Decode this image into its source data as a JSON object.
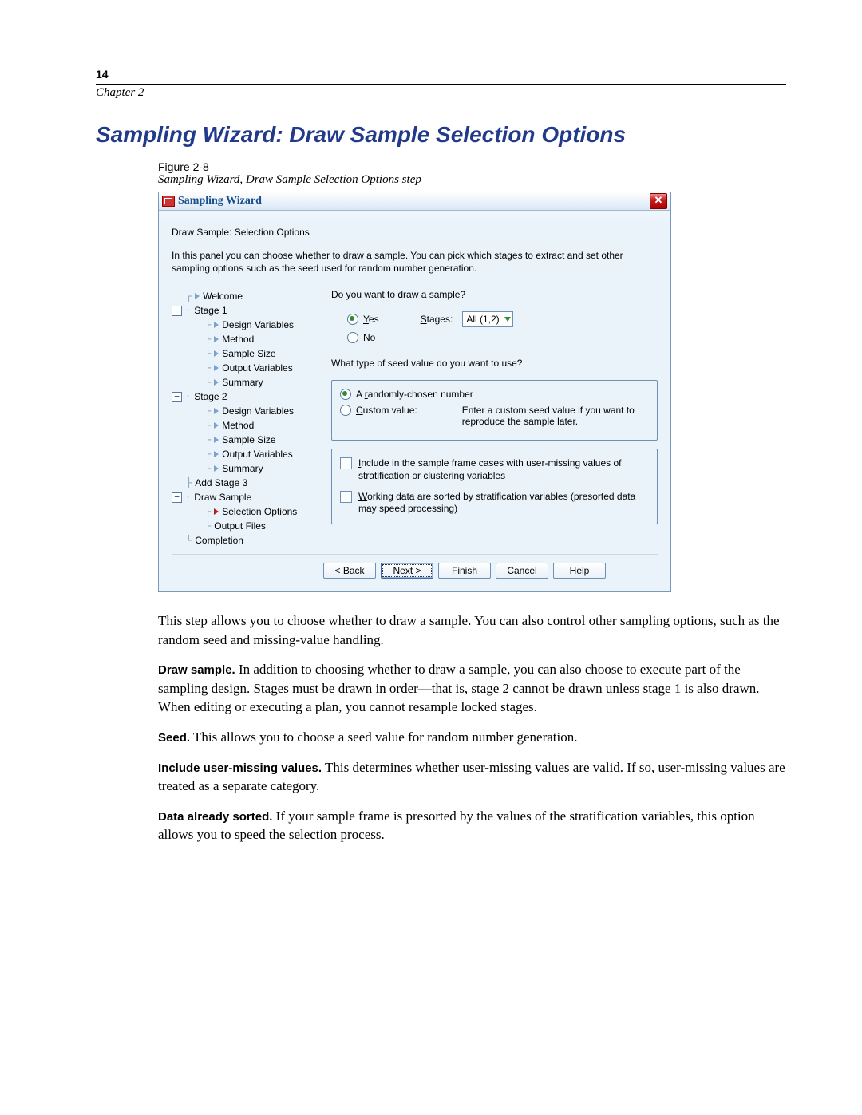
{
  "page_number": "14",
  "chapter": "Chapter 2",
  "headline": "Sampling Wizard: Draw Sample Selection Options",
  "figure_label": "Figure 2-8",
  "figure_caption": "Sampling Wizard, Draw Sample Selection Options step",
  "dialog": {
    "title": "Sampling Wizard",
    "close": "✕",
    "panel_title": "Draw Sample: Selection Options",
    "panel_text": "In this panel you can choose whether to draw  a sample. You can pick which stages to extract and set other sampling options such as the seed used for random number generation.",
    "tree": {
      "welcome": "Welcome",
      "stage1": "Stage 1",
      "design_vars": "Design Variables",
      "method": "Method",
      "sample_size": "Sample Size",
      "output_vars": "Output Variables",
      "summary": "Summary",
      "stage2": "Stage 2",
      "add_stage3": "Add Stage 3",
      "draw_sample": "Draw Sample",
      "selection_options": "Selection Options",
      "output_files": "Output Files",
      "completion": "Completion"
    },
    "right": {
      "q1": "Do you want to draw a sample?",
      "yes_html": "<span class='u'>Y</span>es",
      "no_html": "N<span class='u'>o</span>",
      "stages_label_html": "<span class='u'>S</span>tages:",
      "stages_value": "All (1,2)",
      "q2": "What type of seed value do you want to use?",
      "random_html": "A <span class='u'>r</span>andomly-chosen number",
      "custom_html": "<span class='u'>C</span>ustom value:",
      "custom_hint": "Enter a custom seed value if you want to reproduce the sample later.",
      "chk1_html": "<span class='u'>I</span>nclude in the sample frame cases with user-missing values of stratification or clustering variables",
      "chk2_html": "<span class='u'>W</span>orking data are sorted by stratification variables (presorted data may speed processing)"
    },
    "buttons": {
      "back_html": "&lt; <span class='u'>B</span>ack",
      "next_html": "<span class='u'>N</span>ext &gt;",
      "finish": "Finish",
      "cancel": "Cancel",
      "help": "Help"
    }
  },
  "body": {
    "p1": "This step allows you to choose whether to draw a sample. You can also control other sampling options, such as the random seed and missing-value handling.",
    "draw_lead": "Draw sample.",
    "draw_text": " In addition to choosing whether to draw a sample, you can also choose to execute part of the sampling design. Stages must be drawn in order—that is, stage 2 cannot be drawn unless stage 1 is also drawn. When editing or executing a plan, you cannot resample locked stages.",
    "seed_lead": "Seed.",
    "seed_text": " This allows you to choose a seed value for random number generation.",
    "umv_lead": "Include user-missing values.",
    "umv_text": " This determines whether user-missing values are valid. If so, user-missing values are treated as a separate category.",
    "das_lead": "Data already sorted.",
    "das_text": " If your sample frame is presorted by the values of the stratification variables, this option allows you to speed the selection process."
  }
}
